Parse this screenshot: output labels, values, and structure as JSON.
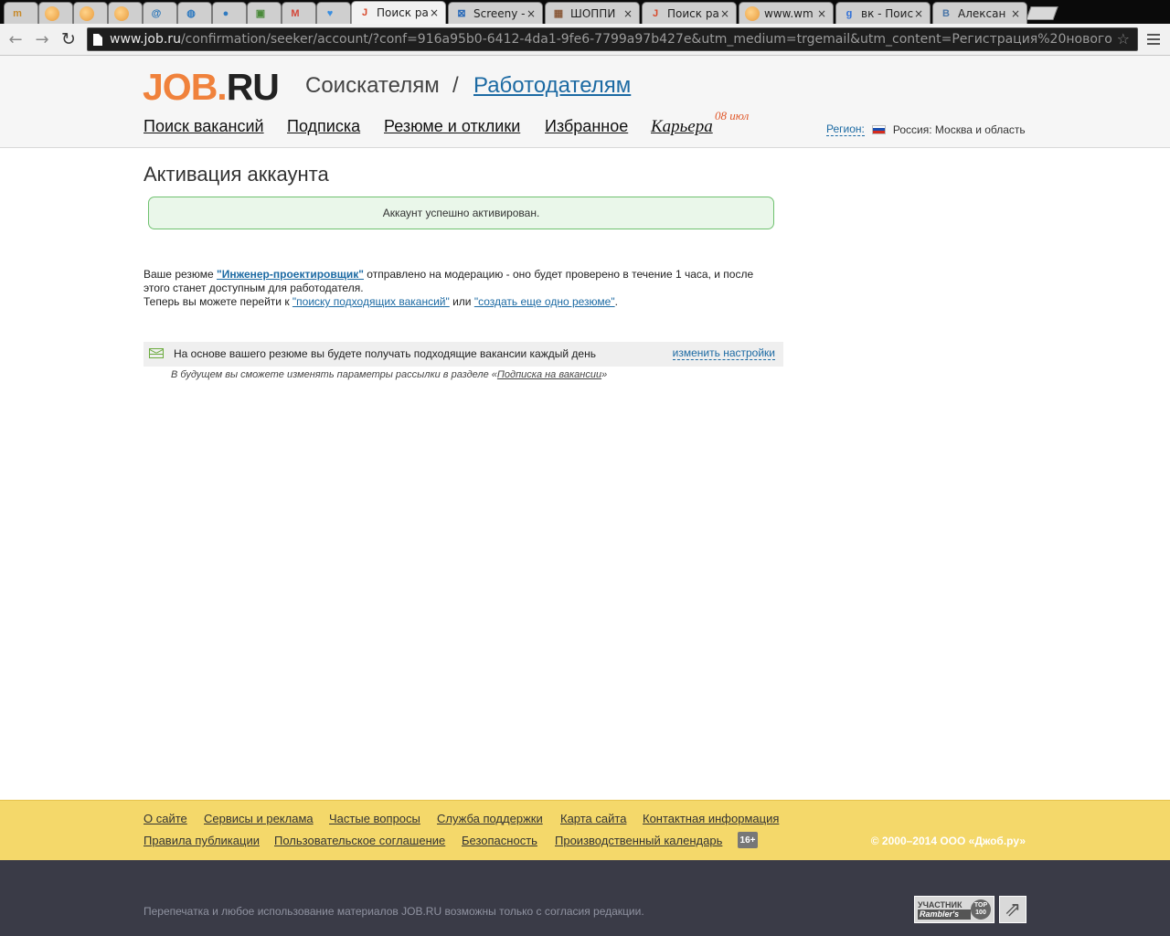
{
  "browser": {
    "tabs": [
      {
        "label": "",
        "icon": "m-favicon-icon",
        "glyph": "m",
        "fav_color": "#c88a2a",
        "active": false
      },
      {
        "label": "",
        "icon": "orange-sphere-icon",
        "glyph": "",
        "fav_color": "#e89a3a",
        "active": false
      },
      {
        "label": "",
        "icon": "orange-sphere-icon",
        "glyph": "",
        "fav_color": "#e89a3a",
        "active": false
      },
      {
        "label": "",
        "icon": "orange-sphere-icon",
        "glyph": "",
        "fav_color": "#e89a3a",
        "active": false
      },
      {
        "label": "",
        "icon": "at-sign-icon",
        "glyph": "@",
        "fav_color": "#1d6fb8",
        "active": false
      },
      {
        "label": "",
        "icon": "globe-icon",
        "glyph": "◍",
        "fav_color": "#2f7ac0",
        "active": false
      },
      {
        "label": "",
        "icon": "pin-icon",
        "glyph": "●",
        "fav_color": "#2f7ac0",
        "active": false
      },
      {
        "label": "",
        "icon": "image-icon",
        "glyph": "▣",
        "fav_color": "#4a8a3a",
        "active": false
      },
      {
        "label": "",
        "icon": "gmail-icon",
        "glyph": "M",
        "fav_color": "#d44638",
        "active": false
      },
      {
        "label": "",
        "icon": "heart-icon",
        "glyph": "♥",
        "fav_color": "#3a8ee0",
        "active": false
      },
      {
        "label": "Поиск ра",
        "icon": "job-j-icon",
        "glyph": "J",
        "fav_color": "#d8482a",
        "active": true
      },
      {
        "label": "Screeny -",
        "icon": "screeny-icon",
        "glyph": "⊠",
        "fav_color": "#2a6ab8",
        "active": false
      },
      {
        "label": "ШОППИ",
        "icon": "photo-icon",
        "glyph": "▦",
        "fav_color": "#8a5a3a",
        "active": false
      },
      {
        "label": "Поиск ра",
        "icon": "job-j-icon",
        "glyph": "J",
        "fav_color": "#d8482a",
        "active": false
      },
      {
        "label": "www.wm",
        "icon": "orange-sphere-icon",
        "glyph": "",
        "fav_color": "#e89a3a",
        "active": false
      },
      {
        "label": "вк - Поис",
        "icon": "google-icon",
        "glyph": "g",
        "fav_color": "#2f6fd8",
        "active": false
      },
      {
        "label": "Алексан",
        "icon": "vk-icon",
        "glyph": "B",
        "fav_color": "#4a76a8",
        "active": false
      }
    ],
    "close_glyph": "×",
    "url_host": "www.job.ru",
    "url_path": "/confirmation/seeker/account/?conf=916a95b0-6412-4da1-9fe6-7799a97b427e&utm_medium=trgemail&utm_content=Регистрация%20нового"
  },
  "header": {
    "logo_part1": "JOB.",
    "logo_part2": "RU",
    "seekers": "Соискателям",
    "separator": "/",
    "employers": "Работодателям",
    "nav": [
      "Поиск вакансий",
      "Подписка",
      "Резюме и отклики",
      "Избранное",
      "Карьера"
    ],
    "career_date": "08 июл",
    "region_label": "Регион:",
    "region_value": "Россия: Москва и область"
  },
  "main": {
    "title": "Активация аккаунта",
    "success_message": "Аккаунт успешно активирован.",
    "info_prefix": "Ваше резюме ",
    "resume_name": "\"Инженер-проектировщик\"",
    "info_middle": " отправлено на модерацию - оно будет проверено в течение 1 часа, и после этого станет доступным для работодателя.",
    "info_line2_prefix": "Теперь вы можете перейти к ",
    "search_link": "\"поиску подходящих вакансий\"",
    "or_text": " или ",
    "create_link": "\"создать еще одно резюме\"",
    "dot": ".",
    "subscription_text": "На основе вашего резюме вы будете получать подходящие вакансии каждый день",
    "change_settings": "изменить настройки",
    "note_prefix": "В будущем вы сможете изменять параметры рассылки в разделе «",
    "note_link": "Подписка на вакансии",
    "note_suffix": "»"
  },
  "footer": {
    "row1": [
      "О сайте",
      "Сервисы и реклама",
      "Частые вопросы",
      "Служба поддержки",
      "Карта сайта",
      "Контактная информация"
    ],
    "row2": [
      "Правила публикации",
      "Пользовательское соглашение",
      "Безопасность",
      "Производственный календарь"
    ],
    "age_badge": "16+",
    "copyright": "© 2000–2014 ООО «Джоб.ру»",
    "reprint": "Перепечатка и любое использование материалов JOB.RU возможны только с согласия редакции.",
    "rambler_line1": "УЧАСТНИК",
    "rambler_line2": "Rambler's",
    "top100_line1": "TOP",
    "top100_line2": "100"
  },
  "colors": {
    "logo_orange": "#f0823c",
    "link_blue": "#1c6aa3",
    "success_border": "#6fc16f",
    "footer_yellow": "#f4d86a",
    "footer_dark": "#3a3b47"
  }
}
